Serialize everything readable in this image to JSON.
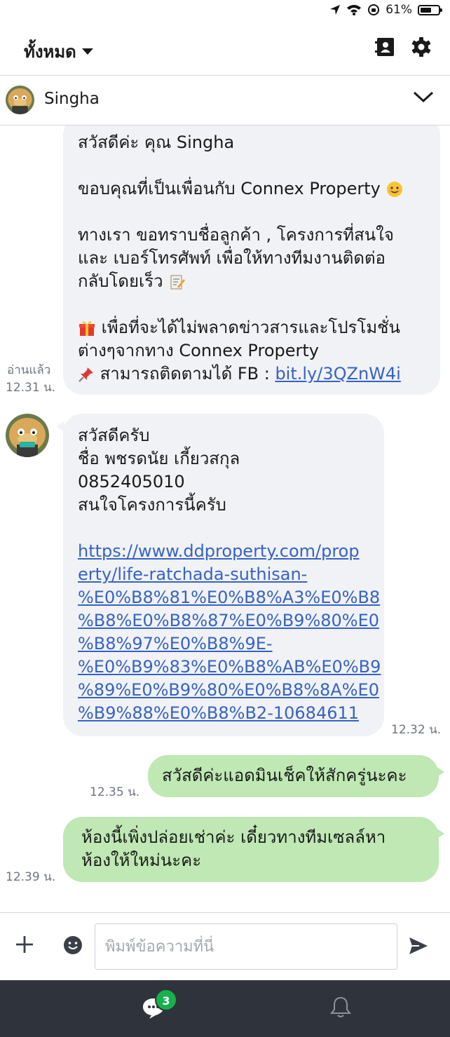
{
  "status": {
    "battery": "61%",
    "battery_level": 0.61
  },
  "header": {
    "filter_label": "ทั้งหมด"
  },
  "contact": {
    "name": "Singha"
  },
  "messages": {
    "m1": {
      "lines": [
        "สวัสดีค่ะ คุณ Singha",
        "",
        "ขอบคุณที่เป็นเพื่อนกับ Connex Property",
        "",
        "ทางเรา ขอทราบชื่อลูกค้า , โครงการที่สนใจ",
        "และ เบอร์โทรศัพท์ เพื่อให้ทางทีมงานติดต่อ",
        "กลับโดยเร็ว",
        "",
        "เพื่อที่จะได้ไม่พลาดข่าวสารและโปรโมชั่น",
        "ต่างๆจากทาง Connex Property",
        "สามารถติดตามได้ FB : "
      ],
      "link": "bit.ly/3QZnW4i",
      "read": "อ่านแล้ว",
      "time": "12.31 น."
    },
    "m2": {
      "lines": [
        "สวัสดีครับ",
        "ชื่อ พชรดนัย เกี้ยวสกุล",
        "0852405010",
        "สนใจโครงการนี้ครับ"
      ],
      "link_lines": [
        "https://www.ddproperty.com/prop",
        "erty/life-ratchada-suthisan-",
        "%E0%B8%81%E0%B8%A3%E0%B8",
        "%B8%E0%B8%87%E0%B9%80%E0",
        "%B8%97%E0%B8%9E-",
        "%E0%B9%83%E0%B8%AB%E0%B9",
        "%89%E0%B9%80%E0%B8%8A%E0",
        "%B9%88%E0%B8%B2-10684611"
      ],
      "time": "12.32 น."
    },
    "m3": {
      "text": "สวัสดีค่ะแอดมินเช็คให้สักครู่นะคะ",
      "time": "12.35 น."
    },
    "m4": {
      "lines": [
        "ห้องนี้เพิ่งปล่อยเช่าค่ะ เดี๋ยวทางทีมเซลล์หา",
        "ห้องให้ใหม่นะคะ"
      ],
      "time": "12.39 น."
    }
  },
  "composer": {
    "placeholder": "พิมพ์ข้อความที่นี่"
  },
  "tabs": {
    "chat_badge": "3"
  },
  "icons": {
    "location": "location-arrow-icon",
    "wifi": "wifi-icon",
    "lock": "orientation-lock-icon",
    "contact": "contact-card-icon",
    "settings": "gear-icon",
    "chevron": "chevron-down-icon",
    "plus": "plus-icon",
    "emoji": "emoji-icon",
    "send": "send-icon",
    "chat": "chat-icon",
    "bell": "bell-icon"
  },
  "colors": {
    "outgoing_bubble": "#bfe8b4",
    "incoming_bubble": "#f1f2f5",
    "link": "#3563c6",
    "tabbar": "#2f333b",
    "badge": "#18b04b"
  }
}
